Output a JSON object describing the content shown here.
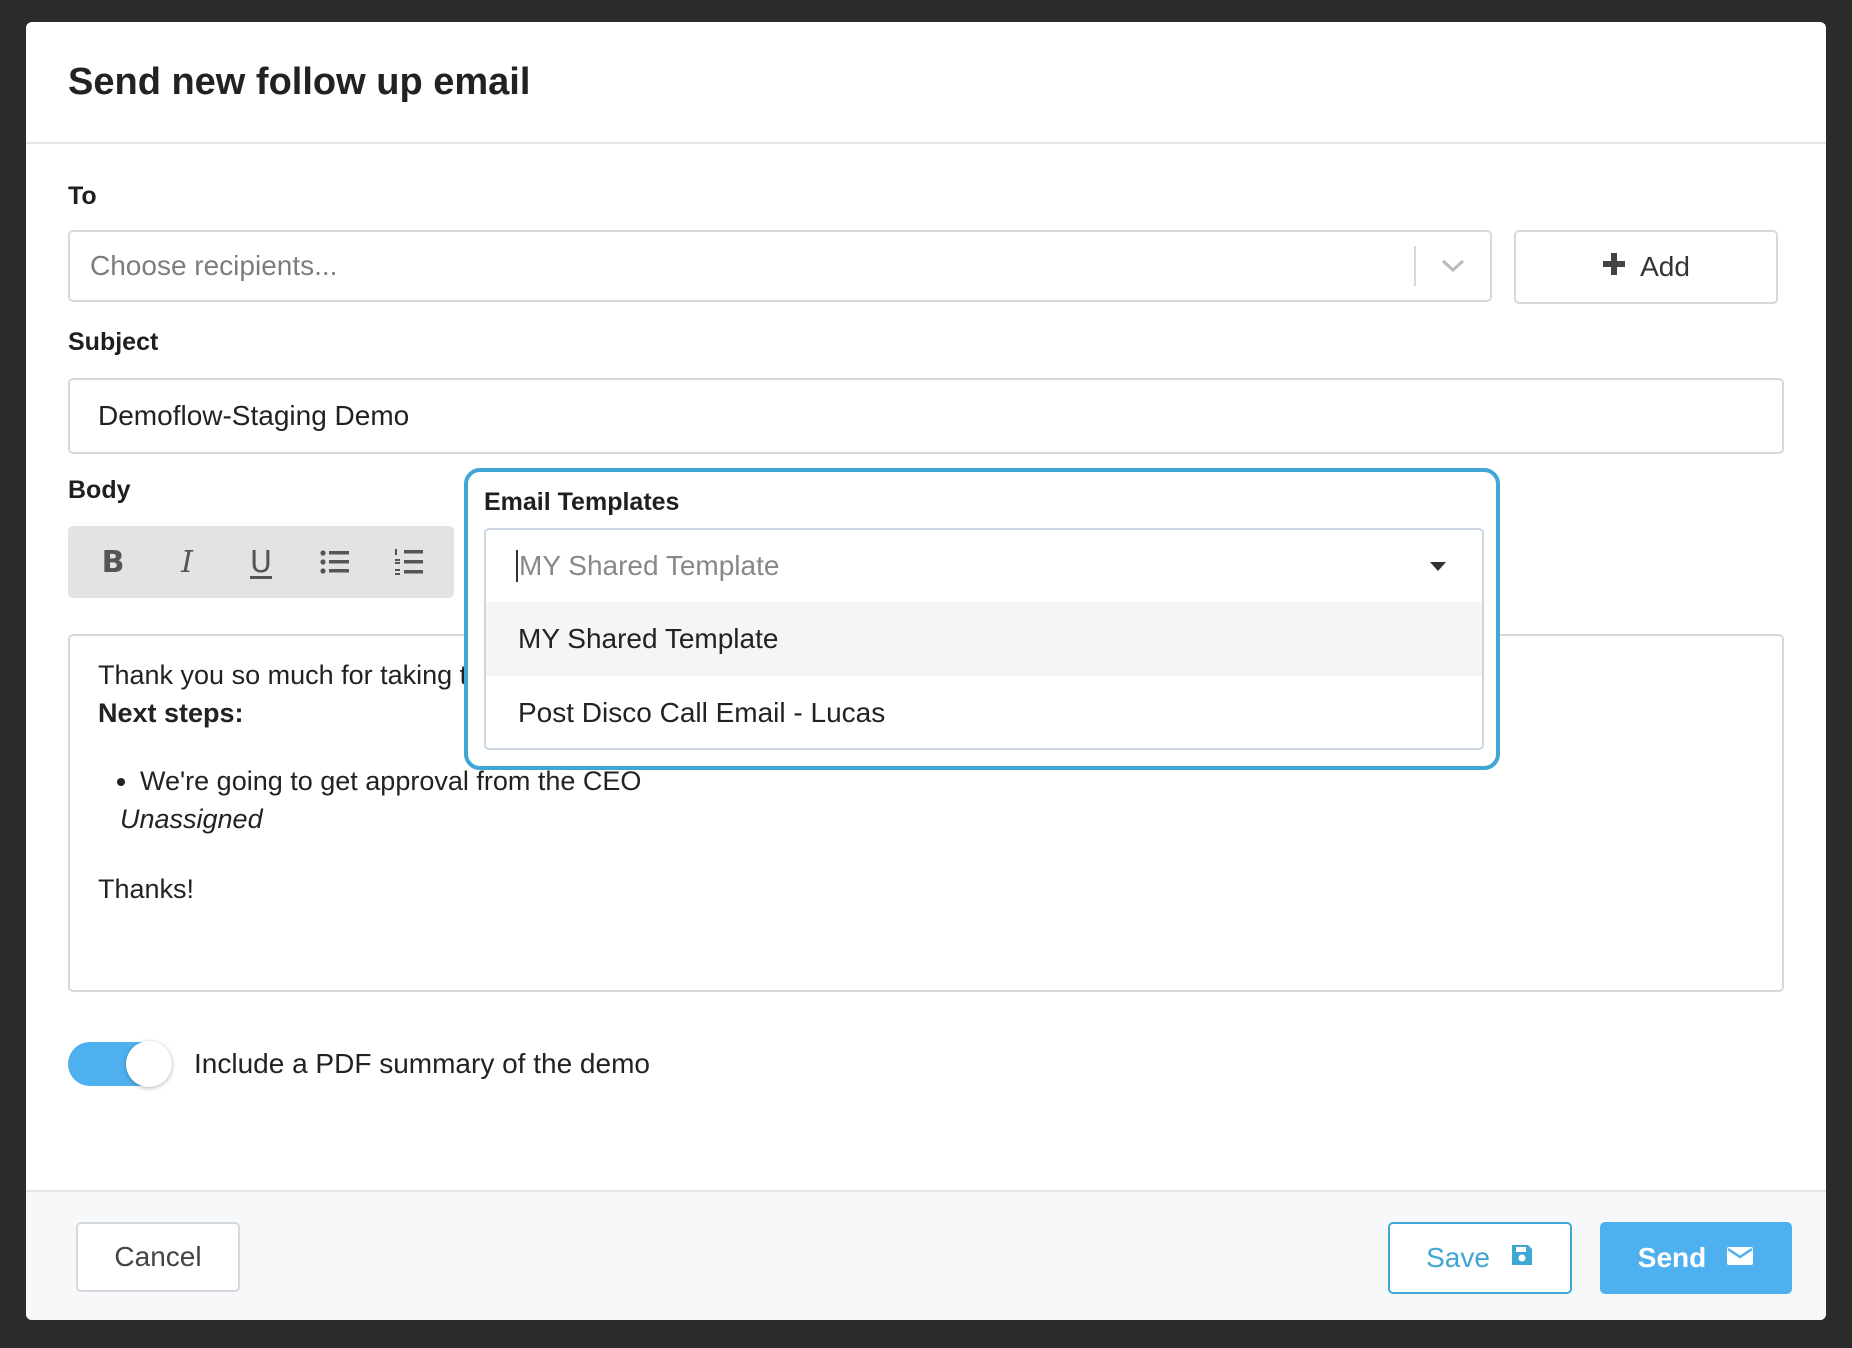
{
  "modal": {
    "title": "Send new follow up email"
  },
  "to": {
    "label": "To",
    "placeholder": "Choose recipients...",
    "add_label": "Add"
  },
  "subject": {
    "label": "Subject",
    "value": "Demoflow-Staging Demo"
  },
  "body": {
    "label": "Body",
    "toolbar": {
      "bold": "B",
      "italic": "I",
      "underline": "U"
    },
    "content": {
      "intro": "Thank you so much for taking th",
      "next_steps": "Next steps:",
      "bullet": "We're going to get approval from the CEO",
      "assignee": "Unassigned",
      "closing": "Thanks!"
    }
  },
  "templates": {
    "label": "Email Templates",
    "selected_placeholder": "MY Shared Template",
    "options": [
      {
        "label": "MY Shared Template",
        "highlighted": true
      },
      {
        "label": "Post Disco Call Email - Lucas",
        "highlighted": false
      }
    ]
  },
  "pdf_toggle": {
    "label": "Include a PDF summary of the demo",
    "enabled": true
  },
  "footer": {
    "cancel_label": "Cancel",
    "save_label": "Save",
    "send_label": "Send"
  },
  "colors": {
    "accent": "#4fb0ef",
    "popover_border": "#3fa6d6",
    "overlay": "#2b2b2b"
  },
  "icons": {
    "to_dropdown": "chevron-down-icon",
    "add": "plus-icon",
    "bullet_list": "bullet-list-icon",
    "numbered_list": "numbered-list-icon",
    "template_dropdown": "caret-down-icon",
    "save": "floppy-disk-icon",
    "send": "envelope-icon"
  }
}
